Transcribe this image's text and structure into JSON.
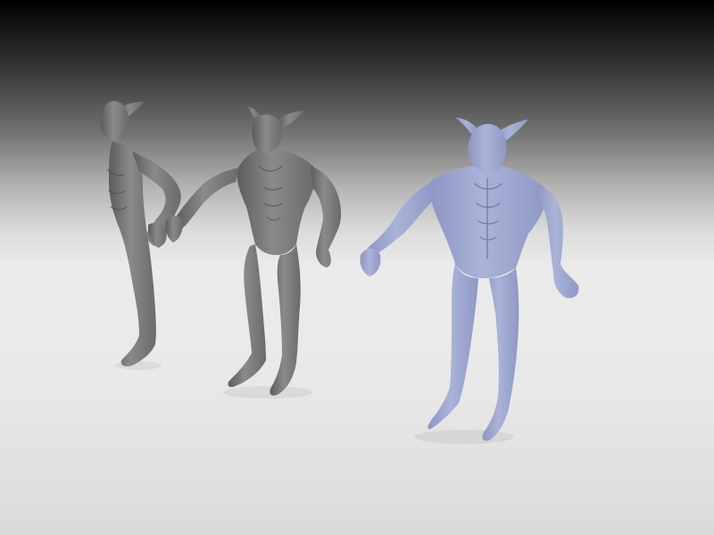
{
  "scene": {
    "type": "3d-render",
    "background": {
      "top_color": "#000000",
      "horizon_color": "#ececec",
      "floor_color": "#dadada"
    },
    "figures": [
      {
        "name": "creature-side-view",
        "material": "gray",
        "color": "#7a7a7a",
        "view": "side"
      },
      {
        "name": "creature-three-quarter-view",
        "material": "gray",
        "color": "#7d7d7d",
        "view": "three-quarter"
      },
      {
        "name": "creature-front-view",
        "material": "blue",
        "color": "#9aa4cc",
        "view": "front"
      }
    ]
  }
}
